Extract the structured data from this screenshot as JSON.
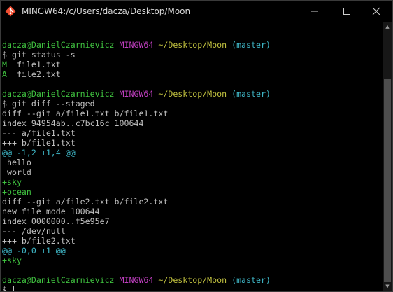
{
  "window": {
    "title": "MINGW64:/c/Users/dacza/Desktop/Moon",
    "icon": "git-bash-icon",
    "buttons": {
      "minimize": "—",
      "maximize": "☐",
      "close": "✕"
    }
  },
  "colors": {
    "green": "#3fc13f",
    "magenta": "#bf3fbf",
    "yellow": "#c1c13f",
    "cyan": "#3fb8c8",
    "text": "#c0c0c0",
    "background": "#000000"
  },
  "terminal": {
    "lines": [
      [
        {
          "t": "",
          "c": "text"
        }
      ],
      [
        {
          "t": "dacza@DanielCzarnievicz ",
          "c": "green"
        },
        {
          "t": "MINGW64 ",
          "c": "magenta"
        },
        {
          "t": "~/Desktop/Moon",
          "c": "yellow"
        },
        {
          "t": " (master)",
          "c": "cyan"
        }
      ],
      [
        {
          "t": "$ git status -s",
          "c": "text"
        }
      ],
      [
        {
          "t": "M",
          "c": "green"
        },
        {
          "t": "  file1.txt",
          "c": "text"
        }
      ],
      [
        {
          "t": "A",
          "c": "green"
        },
        {
          "t": "  file2.txt",
          "c": "text"
        }
      ],
      [
        {
          "t": "",
          "c": "text"
        }
      ],
      [
        {
          "t": "dacza@DanielCzarnievicz ",
          "c": "green"
        },
        {
          "t": "MINGW64 ",
          "c": "magenta"
        },
        {
          "t": "~/Desktop/Moon",
          "c": "yellow"
        },
        {
          "t": " (master)",
          "c": "cyan"
        }
      ],
      [
        {
          "t": "$ git diff --staged",
          "c": "text"
        }
      ],
      [
        {
          "t": "diff --git a/file1.txt b/file1.txt",
          "c": "text"
        }
      ],
      [
        {
          "t": "index 94954ab..c7bc16c 100644",
          "c": "text"
        }
      ],
      [
        {
          "t": "--- a/file1.txt",
          "c": "text"
        }
      ],
      [
        {
          "t": "+++ b/file1.txt",
          "c": "text"
        }
      ],
      [
        {
          "t": "@@ -1,2 +1,4 @@",
          "c": "cyan"
        }
      ],
      [
        {
          "t": " hello",
          "c": "text"
        }
      ],
      [
        {
          "t": " world",
          "c": "text"
        }
      ],
      [
        {
          "t": "+sky",
          "c": "green"
        }
      ],
      [
        {
          "t": "+ocean",
          "c": "green"
        }
      ],
      [
        {
          "t": "diff --git a/file2.txt b/file2.txt",
          "c": "text"
        }
      ],
      [
        {
          "t": "new file mode 100644",
          "c": "text"
        }
      ],
      [
        {
          "t": "index 0000000..f5e95e7",
          "c": "text"
        }
      ],
      [
        {
          "t": "--- /dev/null",
          "c": "text"
        }
      ],
      [
        {
          "t": "+++ b/file2.txt",
          "c": "text"
        }
      ],
      [
        {
          "t": "@@ -0,0 +1 @@",
          "c": "cyan"
        }
      ],
      [
        {
          "t": "+sky",
          "c": "green"
        }
      ],
      [
        {
          "t": "",
          "c": "text"
        }
      ],
      [
        {
          "t": "dacza@DanielCzarnievicz ",
          "c": "green"
        },
        {
          "t": "MINGW64 ",
          "c": "magenta"
        },
        {
          "t": "~/Desktop/Moon",
          "c": "yellow"
        },
        {
          "t": " (master)",
          "c": "cyan"
        }
      ],
      [
        {
          "t": "$ ",
          "c": "text"
        }
      ]
    ]
  },
  "scrollbar": {
    "up_icon": "scroll-up-arrow-icon",
    "down_icon": "scroll-down-arrow-icon",
    "up_glyph": "▲",
    "down_glyph": "▼"
  }
}
